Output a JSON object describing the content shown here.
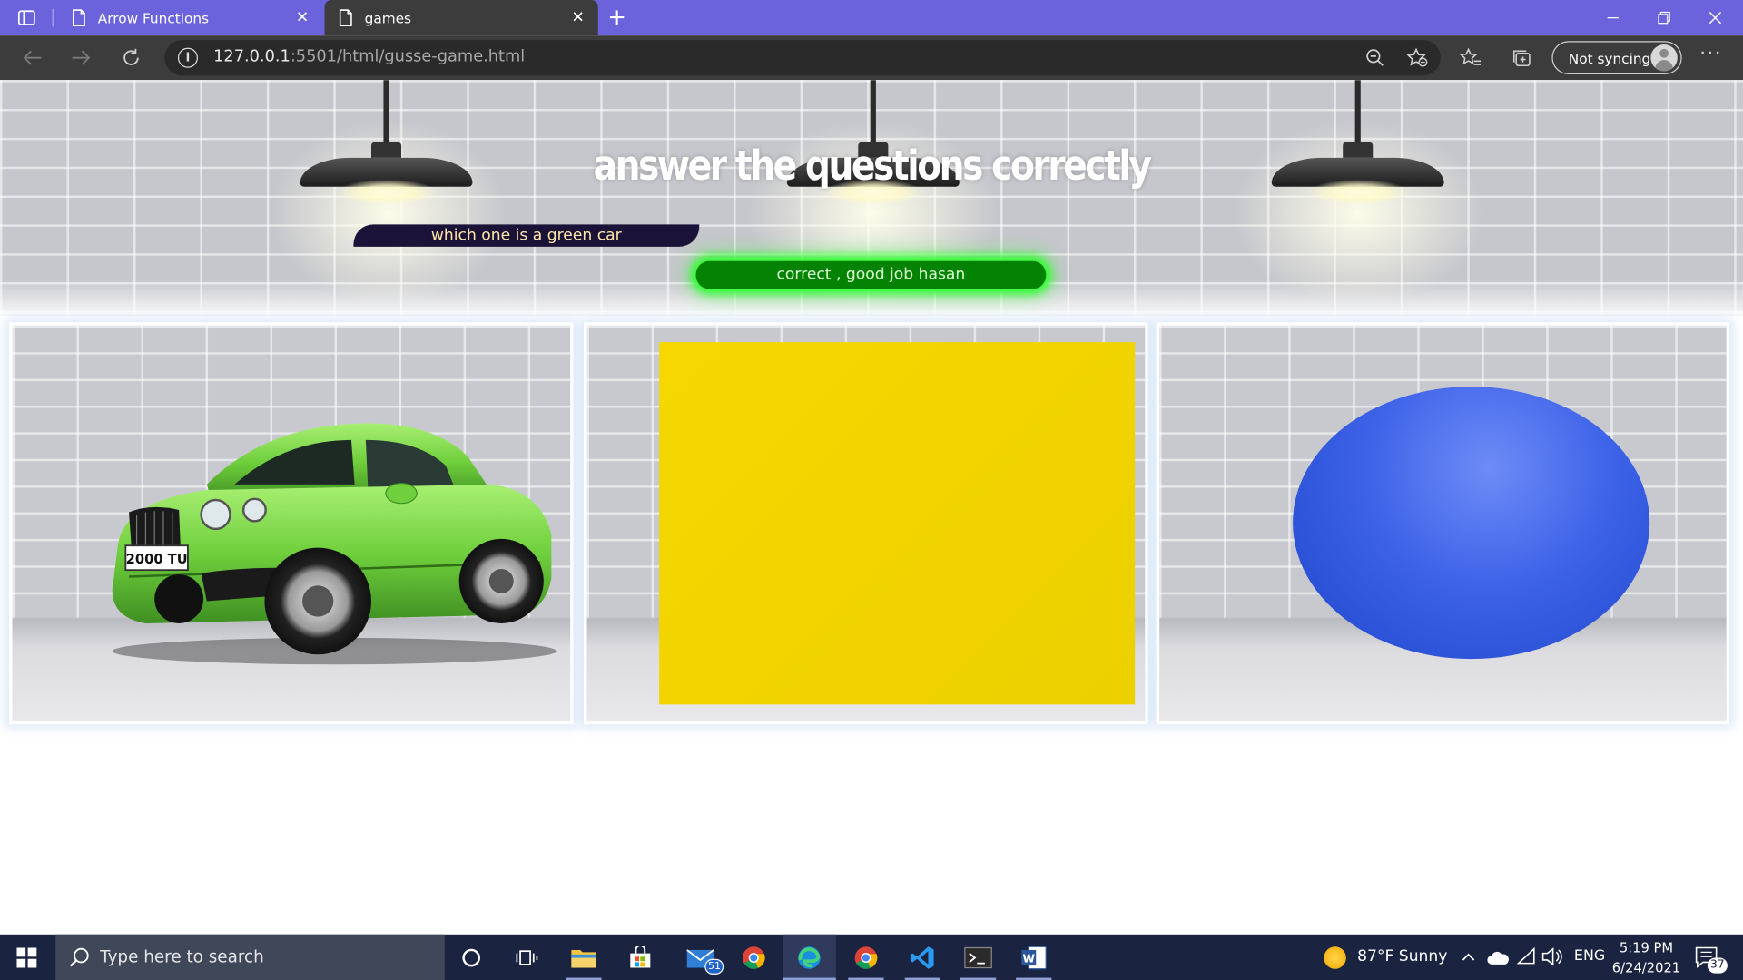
{
  "browser": {
    "tabs": [
      {
        "title": "Arrow Functions",
        "active": false
      },
      {
        "title": "games",
        "active": true
      }
    ],
    "url_host": "127.0.0.1",
    "url_rest": ":5501/html/gusse-game.html",
    "sync_label": "Not syncing"
  },
  "game": {
    "heading": "answer the questions correctly",
    "question": "which one is a green car",
    "result": "correct , good job hasan",
    "options": [
      {
        "name": "green-car",
        "color": "#7ed957",
        "plate": "2000 TU"
      },
      {
        "name": "yellow-box",
        "color": "#f2d600"
      },
      {
        "name": "blue-ellipse",
        "color": "#2f55dd"
      }
    ],
    "accent_green": "#048204",
    "banner_dark": "#1b1238"
  },
  "taskbar": {
    "search_placeholder": "Type here to search",
    "mail_badge": "51",
    "weather": "87°F  Sunny",
    "language": "ENG",
    "time": "5:19 PM",
    "date": "6/24/2021",
    "notifications": "37"
  }
}
